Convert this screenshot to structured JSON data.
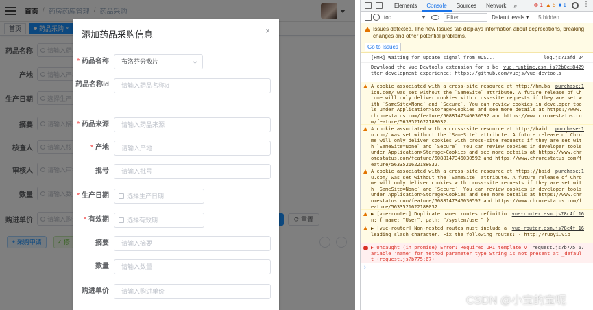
{
  "app": {
    "breadcrumb": [
      "首页",
      "药房药库管理",
      "药品采购"
    ],
    "tags": [
      "首页",
      "药品采购"
    ],
    "search_form": [
      {
        "label": "药品名称",
        "placeholder": "请输入药品名称"
      },
      {
        "label": "产地",
        "placeholder": "请输入产地"
      },
      {
        "label": "生产日期",
        "placeholder": "选择生产日期"
      },
      {
        "label": "摘要",
        "placeholder": "请输入摘要"
      },
      {
        "label": "核查人",
        "placeholder": "请输入核查人"
      },
      {
        "label": "审核人",
        "placeholder": "请输入审核人"
      },
      {
        "label": "数量",
        "placeholder": "请输入数量"
      },
      {
        "label": "购进单价",
        "placeholder": "请输入购进单价"
      }
    ],
    "add_button": "+ 采购申请",
    "edit_button": "✓ 修",
    "reset_button": "⟳ 重置"
  },
  "dialog": {
    "title": "添加药品采购信息",
    "close": "×",
    "fields": [
      {
        "label": "药品名称",
        "required": true,
        "value": "布洛芬分散片",
        "placeholder": ""
      },
      {
        "label": "药品名称id",
        "required": false,
        "value": "",
        "placeholder": "请输入药品名称id"
      },
      {
        "label": "药品来源",
        "required": true,
        "value": "",
        "placeholder": "请输入药品来源"
      },
      {
        "label": "产地",
        "required": true,
        "value": "",
        "placeholder": "请输入产地"
      },
      {
        "label": "批号",
        "required": false,
        "value": "",
        "placeholder": "请输入批号"
      },
      {
        "label": "生产日期",
        "required": true,
        "value": "",
        "placeholder": "选择生产日期"
      },
      {
        "label": "有效期",
        "required": true,
        "value": "",
        "placeholder": "选择有效期"
      },
      {
        "label": "摘要",
        "required": false,
        "value": "",
        "placeholder": "请输入摘要"
      },
      {
        "label": "数量",
        "required": false,
        "value": "",
        "placeholder": "请输入数量"
      },
      {
        "label": "购进单价",
        "required": false,
        "value": "",
        "placeholder": "请输入购进单价"
      }
    ]
  },
  "devtools": {
    "tabs": [
      "Elements",
      "Console",
      "Sources",
      "Network"
    ],
    "active_tab": "Console",
    "more": "»",
    "errors": "1",
    "warnings": "5",
    "info": "1",
    "context": "top",
    "filter_placeholder": "Filter",
    "levels": "Default levels",
    "hidden": "5 hidden",
    "issues_text": "Issues detected. The new Issues tab displays information about deprecations, breaking changes and other potential problems.",
    "goto_issues": "Go to Issues",
    "logs": [
      {
        "type": "log",
        "text": "[HMR] Waiting for update signal from WDS...",
        "src": "log.js?1afd:24"
      },
      {
        "type": "log",
        "text": "Download the Vue Devtools extension for a better development experience: https://github.com/vuejs/vue-devtools",
        "src": "vue.runtime.esm.js?2b0e:8429"
      },
      {
        "type": "warn",
        "text": "A cookie associated with a cross-site resource at http://hm.baidu.com/ was set without the `SameSite` attribute. A future release of Chrome will only deliver cookies with cross-site requests if they are set with `SameSite=None` and `Secure`. You can review cookies in developer tools under Application>Storage>Cookies and see more details at https://www.chromestatus.com/feature/5088147346030592 and https://www.chromestatus.com/feature/5633521622188032.",
        "src": "purchase:1"
      },
      {
        "type": "warn",
        "text": "A cookie associated with a cross-site resource at http://baidu.com/ was set without the `SameSite` attribute. A future release of Chrome will only deliver cookies with cross-site requests if they are set with `SameSite=None` and `Secure`. You can review cookies in developer tools under Application>Storage>Cookies and see more details at https://www.chromestatus.com/feature/5088147346030592 and https://www.chromestatus.com/feature/5633521622188032.",
        "src": "purchase:1"
      },
      {
        "type": "warn",
        "text": "A cookie associated with a cross-site resource at https://baidu.com/ was set without the `SameSite` attribute. A future release of Chrome will only deliver cookies with cross-site requests if they are set with `SameSite=None` and `Secure`. You can review cookies in developer tools under Application>Storage>Cookies and see more details at https://www.chromestatus.com/feature/5088147346030592 and https://www.chromestatus.com/feature/5633521622188032.",
        "src": "purchase:1"
      },
      {
        "type": "warn",
        "text": "▶ [vue-router] Duplicate named routes definition: { name: \"User\", path: \"/system/user\" }",
        "src": "vue-router.esm.js?8c4f:16"
      },
      {
        "type": "warn",
        "text": "▶ [vue-router] Non-nested routes must include a leading slash character. Fix the following routes: - http://ruoyi.vip",
        "src": "vue-router.esm.js?8c4f:16"
      },
      {
        "type": "error",
        "text": "▶ Uncaught (in promise) Error: Required URI template variable 'name' for method parameter type String is not present at _default (request.js?b775:67)",
        "src": "request.js?b775:67"
      }
    ],
    "prompt": "›"
  },
  "watermark": "CSDN @小宝的宝呢"
}
